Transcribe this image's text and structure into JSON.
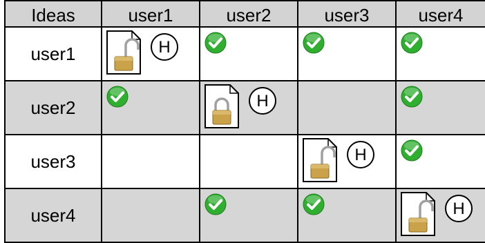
{
  "corner_label": "Ideas",
  "columns": [
    "user1",
    "user2",
    "user3",
    "user4"
  ],
  "rows": [
    {
      "label": "user1",
      "cells": [
        "doc-unlocked",
        "check",
        "check",
        "check"
      ]
    },
    {
      "label": "user2",
      "cells": [
        "check",
        "doc-locked",
        "",
        "check"
      ]
    },
    {
      "label": "user3",
      "cells": [
        "",
        "",
        "doc-unlocked",
        "check"
      ]
    },
    {
      "label": "user4",
      "cells": [
        "",
        "check",
        "check",
        "doc-unlocked"
      ]
    }
  ],
  "hidden_badge_label": "H",
  "colors": {
    "header_bg": "#d3d3d3",
    "row_shade": "#d6d6d6",
    "check_green": "#2fae2f",
    "lock_gold": "#c9a24a"
  }
}
